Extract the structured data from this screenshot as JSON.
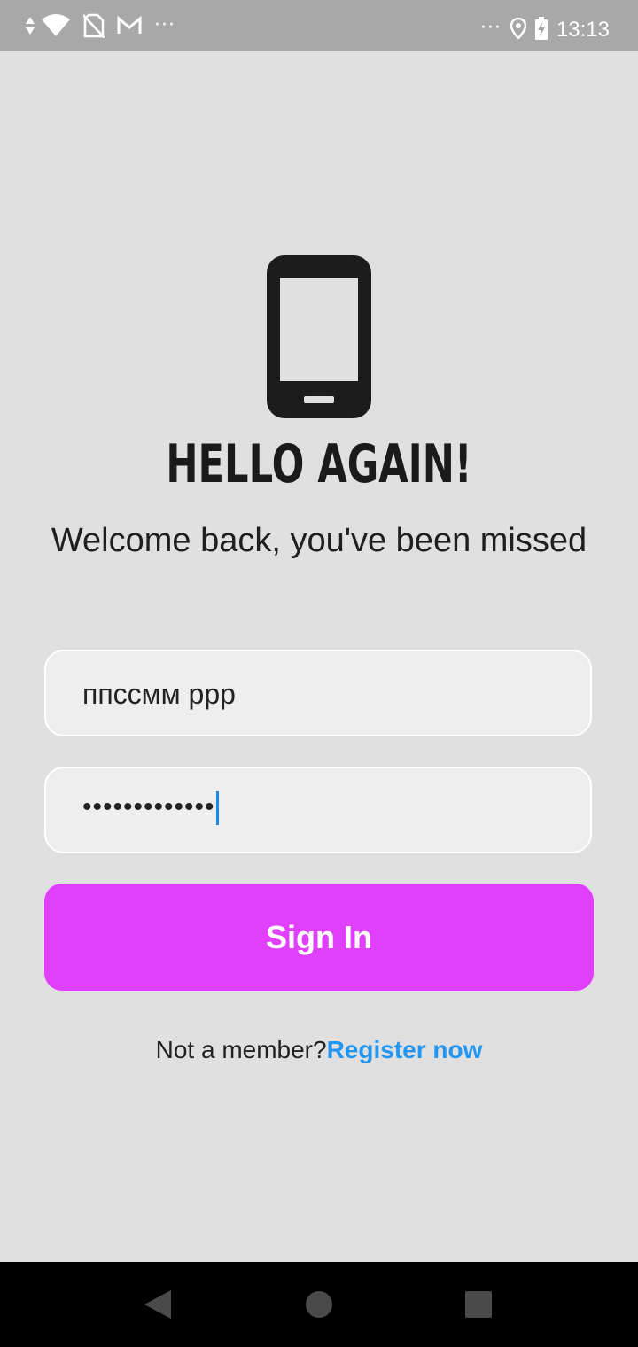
{
  "status_bar": {
    "time": "13:13",
    "left_icons": [
      "data-arrows-icon",
      "wifi-icon",
      "no-sim-icon",
      "gmail-icon"
    ],
    "left_more": "···",
    "right_more": "···",
    "right_icons": [
      "location-icon",
      "battery-charging-icon"
    ]
  },
  "login": {
    "logo_icon": "smartphone-icon",
    "title": "HELLO AGAIN!",
    "subtitle": "Welcome back, you've been missed",
    "username_value": "ппссмм ррр",
    "password_value": "•••••••••••••",
    "sign_in_label": "Sign In",
    "member_prompt": "Not a member?",
    "register_label": "Register now"
  },
  "colors": {
    "background": "#e0e0e0",
    "primary_button": "#e040fb",
    "link": "#2196f3",
    "status_bar": "#a8a8a8",
    "nav_bar": "#000000"
  },
  "nav_bar": {
    "buttons": [
      "back-icon",
      "home-icon",
      "recents-icon"
    ]
  }
}
